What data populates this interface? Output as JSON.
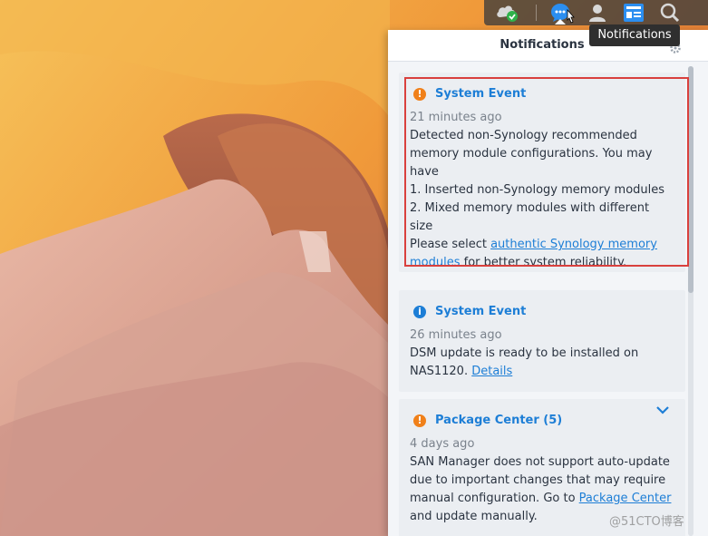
{
  "taskbar": {
    "icons": [
      "cloud-sync-icon",
      "notifications-icon",
      "user-icon",
      "widgets-icon",
      "search-icon"
    ]
  },
  "tooltip": {
    "text": "Notifications"
  },
  "panel": {
    "title": "Notifications",
    "notifications": [
      {
        "severity": "warning",
        "severity_color": "#f0801a",
        "title": "System Event",
        "time": "21 minutes ago",
        "lines": [
          "Detected non-Synology recommended",
          "memory module configurations. You may",
          "have",
          "1. Inserted non-Synology memory modules",
          "2. Mixed memory modules with different",
          "size"
        ],
        "last_line_prefix": "Please select ",
        "link_text_1": "authentic Synology memory",
        "link_text_2": "modules",
        "last_line_suffix": " for better system reliability."
      },
      {
        "severity": "info",
        "severity_color": "#1d7ed6",
        "title": "System Event",
        "time": "26 minutes ago",
        "line1": "DSM update is ready to be installed on",
        "line2_prefix": "NAS1120. ",
        "link_text": "Details"
      },
      {
        "severity": "warning",
        "severity_color": "#f0801a",
        "title": "Package Center (5)",
        "time": "4 days ago",
        "lines": [
          "SAN Manager does not support auto-update",
          "due to important changes that may require"
        ],
        "line3_prefix": "manual configuration. Go to ",
        "link_text": "Package Center",
        "line4": "and update manually."
      }
    ]
  },
  "watermark": "@51CTO博客"
}
